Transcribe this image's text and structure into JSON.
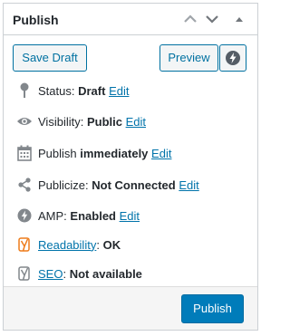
{
  "header": {
    "title": "Publish"
  },
  "buttons": {
    "save_draft": "Save Draft",
    "preview": "Preview",
    "publish": "Publish"
  },
  "status": {
    "label": "Status:",
    "value": "Draft",
    "edit": "Edit"
  },
  "visibility": {
    "label": "Visibility:",
    "value": "Public",
    "edit": "Edit"
  },
  "schedule": {
    "label": "Publish",
    "value": "immediately",
    "edit": "Edit"
  },
  "publicize": {
    "label": "Publicize:",
    "value": "Not Connected",
    "edit": "Edit"
  },
  "amp": {
    "label": "AMP:",
    "value": "Enabled",
    "edit": "Edit"
  },
  "readability": {
    "link": "Readability",
    "sep": ":",
    "value": "OK"
  },
  "seo": {
    "link": "SEO",
    "sep": ":",
    "value": "Not available"
  },
  "icons": {
    "collapse_up": "chevron-up-icon",
    "expand_down": "chevron-down-icon",
    "toggle": "triangle-up-icon",
    "amp_preview": "lightning-bolt-icon",
    "status": "pin-icon",
    "visibility": "eye-icon",
    "schedule": "calendar-icon",
    "publicize": "share-icon",
    "amp": "lightning-bolt-icon",
    "readability": "yoast-icon",
    "seo": "yoast-icon"
  },
  "colors": {
    "accent": "#0071a1",
    "primary": "#007cba",
    "link": "#0073aa",
    "yoast_ok": "#ee7c1b",
    "icon": "#82878c"
  }
}
